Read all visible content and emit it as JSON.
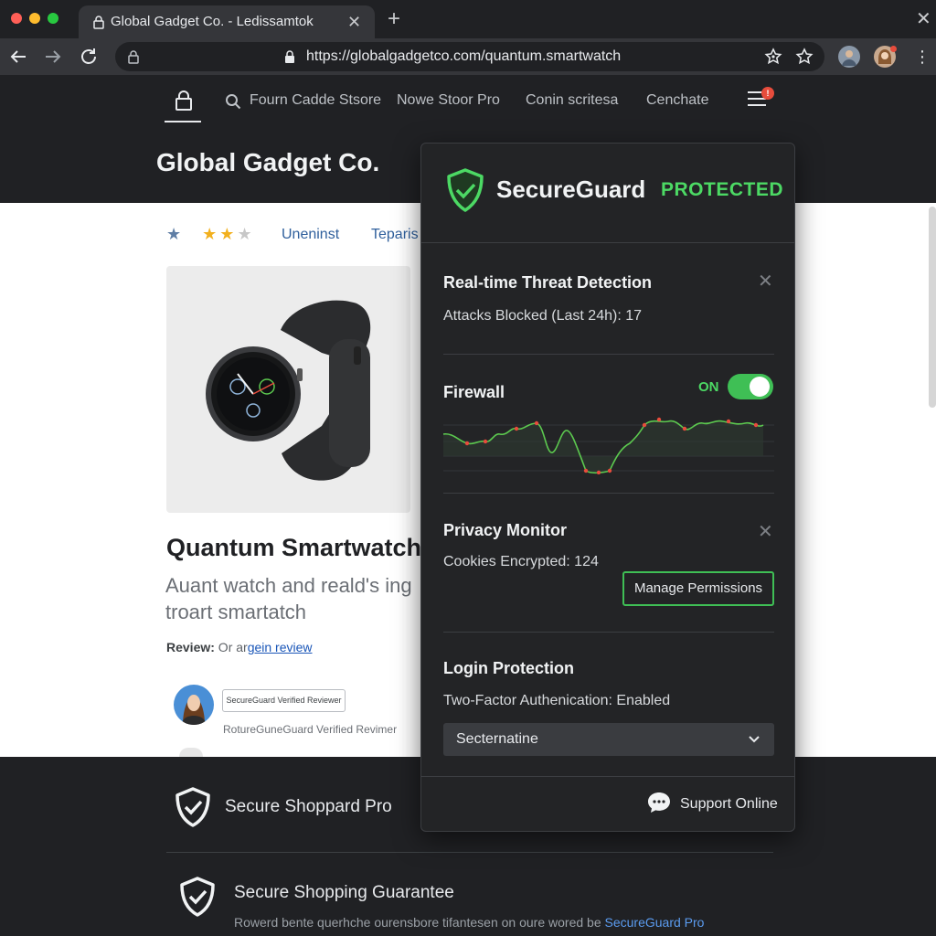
{
  "browser": {
    "tab_title": "Global Gadget Co. - Ledissamtok",
    "url": "https://globalgadgetco.com/quantum.smartwatch"
  },
  "site": {
    "brand": "Global Gadget Co.",
    "nav": [
      "Fourn Cadde Stsore",
      "Nowe Stoor Pro",
      "Conin scritesa",
      "Cenchate"
    ],
    "notification_count": "!"
  },
  "product": {
    "rating_stars": 3,
    "rating_links": [
      "Uneninst",
      "Teparis"
    ],
    "title": "Quantum Smartwatch",
    "description": "Auant watch and reald's ing troart smartatch",
    "review_label": "Review:",
    "review_prefix": " Or ar",
    "review_link": "gein review",
    "verified_badge": "SecureGuard Verified Reviewer",
    "reviewer_name": "RotureGuneGuard Verified Revimer"
  },
  "footer": {
    "item1_title": "Secure Shoppard Pro",
    "item2_title": "Secure Shopping Guarantee",
    "text_prefix": "Rowerd bente querhche ourensbore tifantesen on oure wored be ",
    "text_link": "SecureGuard Pro"
  },
  "popup": {
    "title": "SecureGuard",
    "status": "PROTECTED",
    "threat": {
      "title": "Real-time Threat Detection",
      "text": "Attacks Blocked (Last 24h): 17"
    },
    "firewall": {
      "title": "Firewall",
      "toggle_label": "ON",
      "enabled": true
    },
    "privacy": {
      "title": "Privacy Monitor",
      "text": "Cookies Encrypted: 124",
      "button": "Manage Permissions"
    },
    "login": {
      "title": "Login Protection",
      "text": "Two-Factor Authenication: Enabled",
      "select_value": "Secternatine"
    },
    "support_label": "Support Online"
  },
  "colors": {
    "accent_green": "#4cd964",
    "chart_line": "#5cc94f",
    "chart_dot": "#e74c3c",
    "link_blue": "#2f5f9c"
  },
  "icons": [
    "lock-icon",
    "search-icon",
    "menu-icon",
    "shield-check-icon",
    "close-icon",
    "chevron-down-icon",
    "chat-bubble-icon",
    "star-icon",
    "bookmark-star-icon",
    "reload-icon",
    "back-arrow-icon",
    "forward-arrow-icon"
  ]
}
